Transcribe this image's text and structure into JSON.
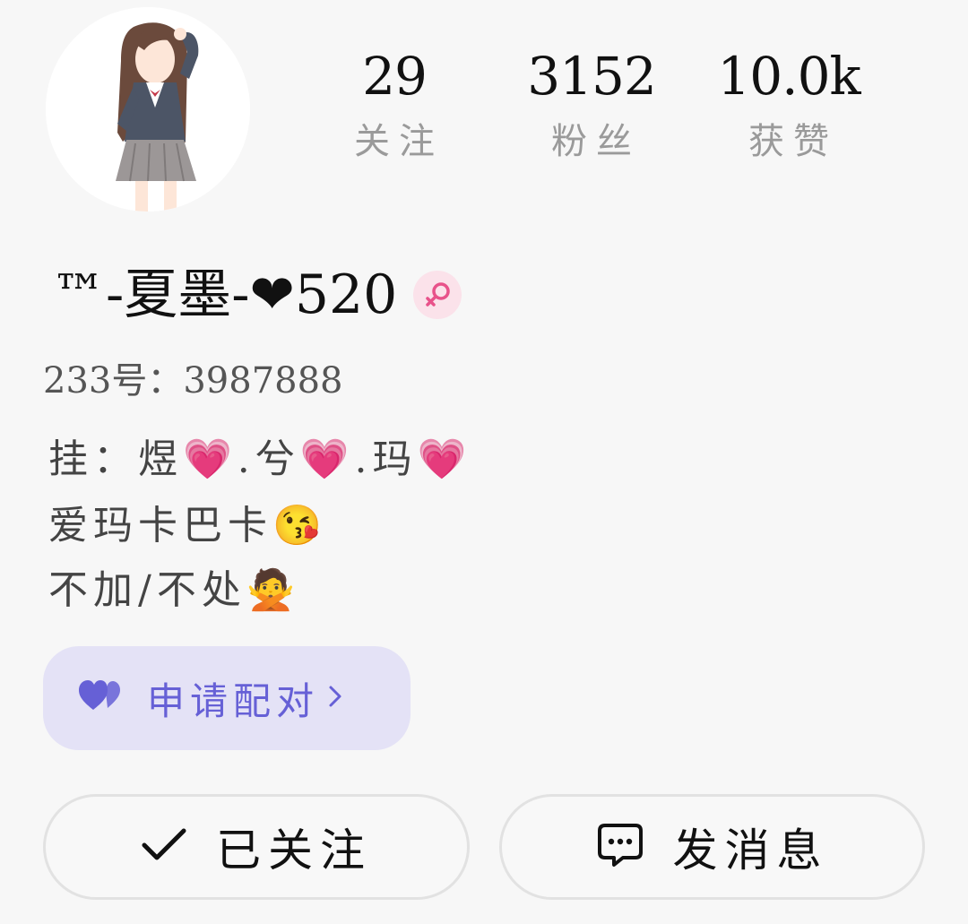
{
  "profile": {
    "avatar_icon": "anime-girl-avatar",
    "name": "™-夏墨-❤520",
    "gender_icon": "female-icon",
    "gender_color": "#e8528a",
    "uid_text": "233号：3987888"
  },
  "stats": [
    {
      "value": "29",
      "label": "关注"
    },
    {
      "value": "3152",
      "label": "粉丝"
    },
    {
      "value": "10.0k",
      "label": "获赞"
    }
  ],
  "bio": [
    "挂：煜💗.兮💗.玛💗",
    "爱玛卡巴卡😘",
    "不加/不处🙅"
  ],
  "pair_button": {
    "icon": "double-heart-icon",
    "label": "申请配对",
    "color": "#6660d6"
  },
  "actions": {
    "follow_label": "已关注",
    "message_label": "发消息"
  }
}
